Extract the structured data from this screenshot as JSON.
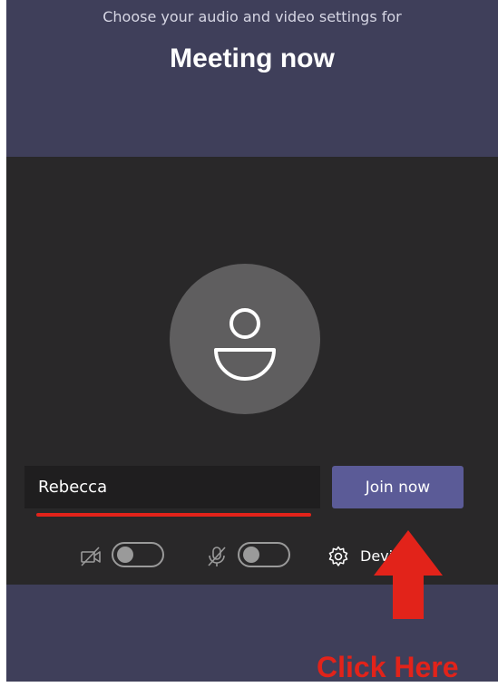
{
  "header": {
    "subtitle": "Choose your audio and video settings for",
    "title": "Meeting now"
  },
  "preview": {
    "avatar_icon": "person-icon"
  },
  "join_form": {
    "name_value": "Rebecca",
    "join_label": "Join now"
  },
  "controls": {
    "camera_icon": "camera-off-icon",
    "camera_toggle_on": false,
    "mic_icon": "mic-off-icon",
    "mic_toggle_on": false,
    "devices_icon": "gear-icon",
    "devices_label": "Devi"
  },
  "annotation": {
    "text": "Click Here",
    "color": "#e2231a"
  },
  "colors": {
    "panel_bg": "#3f3f5a",
    "video_bg": "#292829",
    "accent": "#5b5b97"
  }
}
